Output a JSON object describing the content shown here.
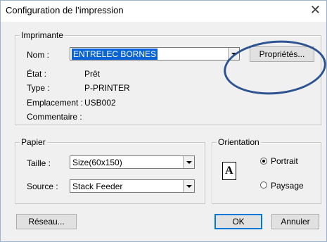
{
  "window": {
    "title": "Configuration de l’impression",
    "close_glyph": "✕"
  },
  "printer": {
    "legend": "Imprimante",
    "name_label": "Nom :",
    "name_value": "ENTRELEC BORNES",
    "properties_button": "Propriétés...",
    "status_label": "État :",
    "status_value": "Prêt",
    "type_label": "Type :",
    "type_value": "P-PRINTER",
    "location_label": "Emplacement :",
    "location_value": "USB002",
    "comment_label": "Commentaire :",
    "comment_value": ""
  },
  "paper": {
    "legend": "Papier",
    "size_label": "Taille :",
    "size_value": "Size(60x150)",
    "source_label": "Source :",
    "source_value": "Stack Feeder"
  },
  "orientation": {
    "legend": "Orientation",
    "icon_letter": "A",
    "portrait_label": "Portrait",
    "landscape_label": "Paysage",
    "selected": "portrait"
  },
  "buttons": {
    "network": "Réseau...",
    "ok": "OK",
    "cancel": "Annuler"
  },
  "annotation": {
    "color": "#2d5390",
    "shape": "ellipse"
  }
}
